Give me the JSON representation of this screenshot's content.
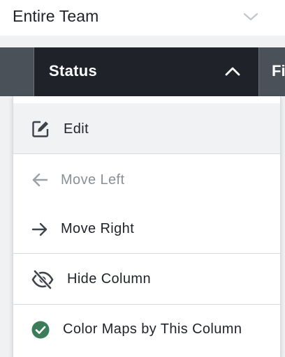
{
  "team_selector": {
    "label": "Entire Team",
    "icon": "chevron-down-icon"
  },
  "column_header": {
    "active_column": "Status",
    "active_icon": "chevron-up-icon",
    "next_column_partial": "Fi"
  },
  "menu": {
    "items": [
      {
        "label": "Edit",
        "icon": "edit-icon",
        "enabled": true
      },
      {
        "label": "Move Left",
        "icon": "arrow-left-icon",
        "enabled": false
      },
      {
        "label": "Move Right",
        "icon": "arrow-right-icon",
        "enabled": true
      },
      {
        "label": "Hide Column",
        "icon": "eye-off-icon",
        "enabled": true
      },
      {
        "label": "Color Maps by This Column",
        "icon": "check-circle-icon",
        "enabled": true,
        "checked": true
      }
    ]
  },
  "colors": {
    "header_bg": "#1f2329",
    "check_green": "#3a7d58",
    "disabled_text": "#8a8f96"
  }
}
